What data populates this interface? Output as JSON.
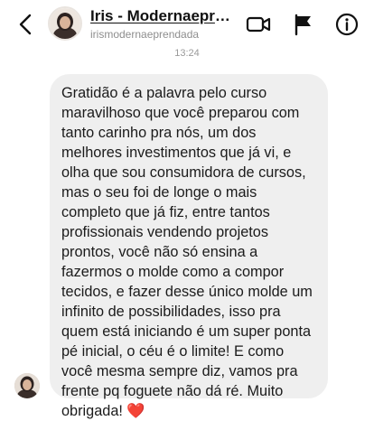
{
  "header": {
    "title": "Iris - Modernaepre…",
    "username": "irismodernaeprendada",
    "icons": [
      "back-arrow-icon",
      "video-call-icon",
      "report-flag-icon",
      "info-icon"
    ]
  },
  "chat": {
    "timestamp": "13:24",
    "message_text": "Gratidão é a palavra pelo curso\nmaravilhoso que você preparou com\ntanto carinho pra nós, um dos\nmelhores investimentos que já vi, e\nolha que sou consumidora de cursos,\nmas o seu foi de longe o mais\ncompleto que já fiz, entre tantos\nprofissionais vendendo projetos\nprontos, você não só ensina a\nfazermos o molde como a compor\ntecidos, e fazer desse único molde um\ninfinito de possibilidades, isso pra\nquem está iniciando é um super ponta\npé inicial, o céu é o limite! E como\nvocê mesma sempre diz, vamos pra\nfrente pq foguete não dá ré. Muito\nobrigada! ",
    "emoji": "❤️"
  },
  "colors": {
    "bubble_bg": "#efefef",
    "heart": "#e0202b",
    "muted_text": "#8e8e8e"
  }
}
